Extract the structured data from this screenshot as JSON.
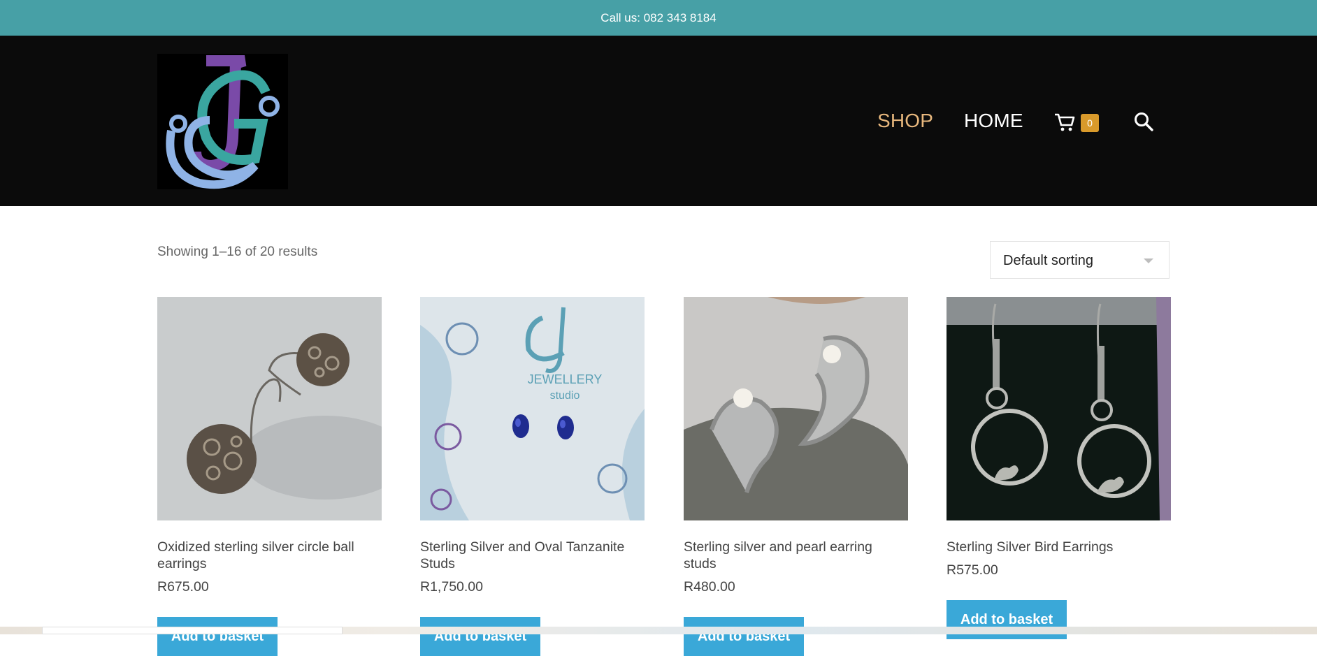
{
  "topbar": {
    "call_text": "Call us: 082 343 8184"
  },
  "nav": {
    "shop": "SHOP",
    "home": "HOME",
    "cart_count": "0",
    "cart_icon": "cart-icon",
    "search_icon": "search-icon"
  },
  "colors": {
    "topbar": "#47a0a6",
    "header": "#0b0b0b",
    "active_nav": "#e7b77d",
    "cart_badge": "#d99a2b",
    "button": "#3aa8d8"
  },
  "results": {
    "text": "Showing 1–16 of 20 results"
  },
  "sorting": {
    "selected": "Default sorting"
  },
  "products": [
    {
      "title": "Oxidized sterling silver circle ball earrings",
      "price": "R675.00",
      "button": "Add to basket"
    },
    {
      "title": "Sterling Silver and Oval Tanzanite Studs",
      "price": "R1,750.00",
      "button": "Add to basket"
    },
    {
      "title": "Sterling silver and pearl earring studs",
      "price": "R480.00",
      "button": "Add to basket"
    },
    {
      "title": "Sterling Silver Bird Earrings",
      "price": "R575.00",
      "button": "Add to basket"
    }
  ],
  "product_images": {
    "card2_brand_line1": "JEWELLERY",
    "card2_brand_line2": "studio"
  }
}
